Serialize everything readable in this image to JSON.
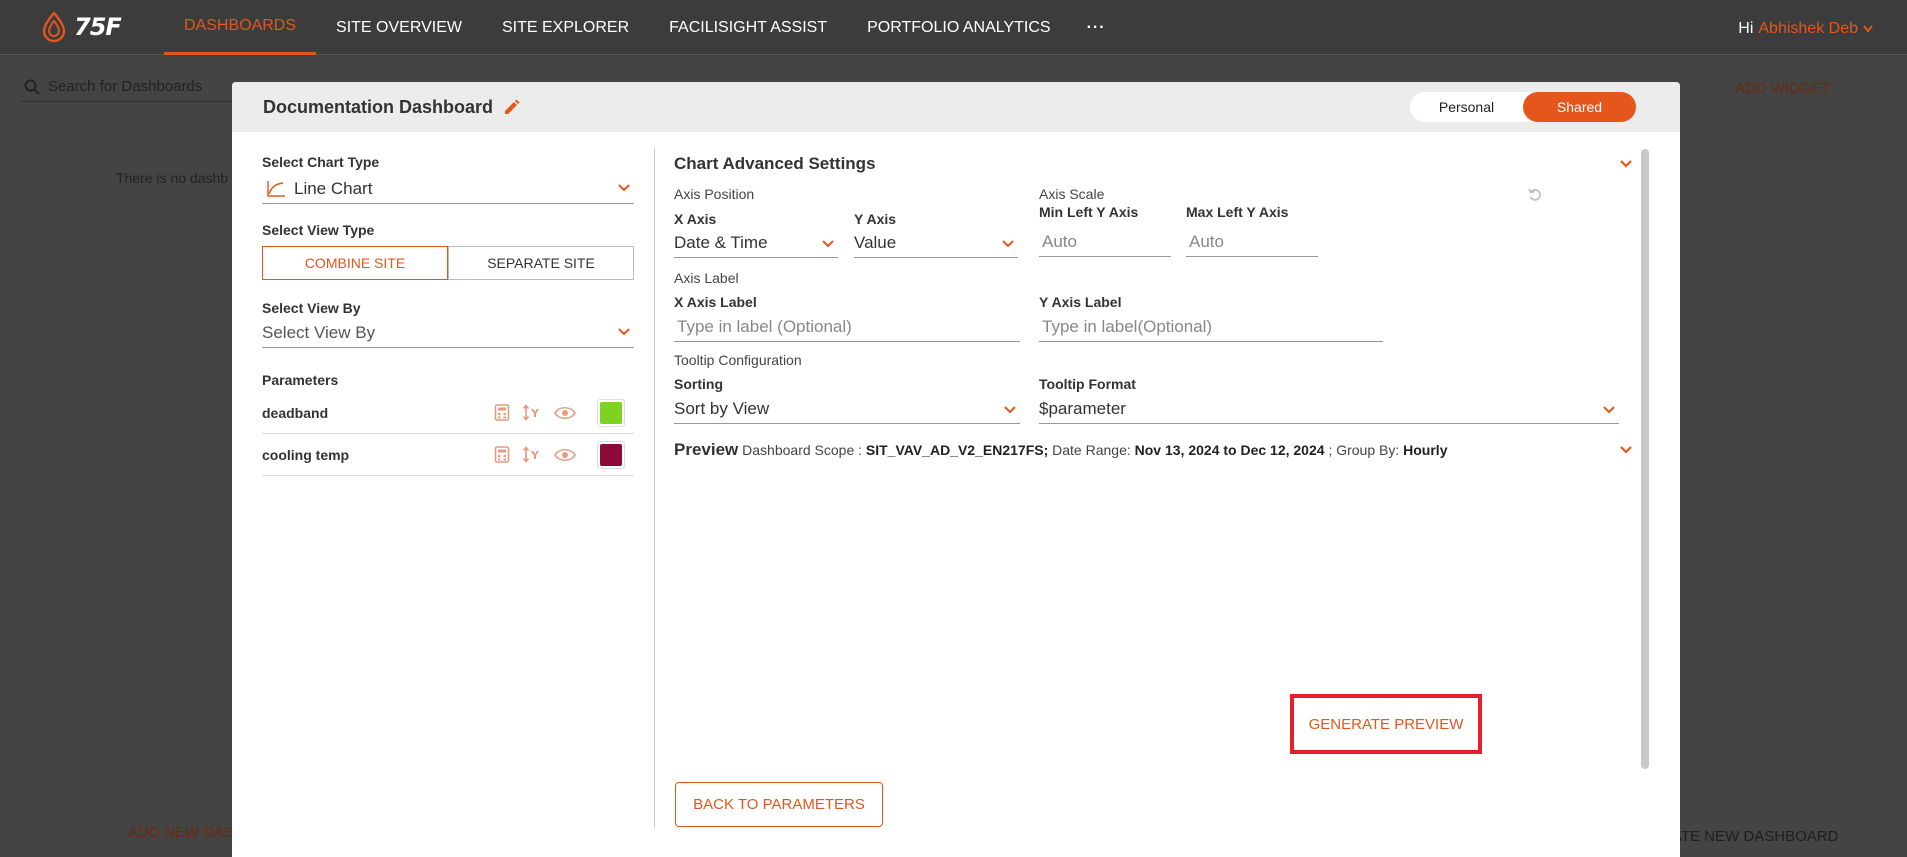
{
  "nav": {
    "logo_text": "75F",
    "items": [
      {
        "label": "DASHBOARDS",
        "active": true
      },
      {
        "label": "SITE OVERVIEW",
        "active": false
      },
      {
        "label": "SITE EXPLORER",
        "active": false
      },
      {
        "label": "FACILISIGHT ASSIST",
        "active": false
      },
      {
        "label": "PORTFOLIO ANALYTICS",
        "active": false
      }
    ],
    "more": "···",
    "greeting": "Hi",
    "user_name": "Abhishek Deb"
  },
  "background": {
    "search_placeholder": "Search for Dashboards",
    "add_widget": "ADD WIDGET",
    "empty_text": "There is no dashb",
    "add_new": "ADD NEW DAS",
    "create_new": "ATE NEW DASHBOARD"
  },
  "modal": {
    "title": "Documentation Dashboard",
    "toggle": {
      "personal": "Personal",
      "shared": "Shared",
      "selected": "Shared"
    },
    "left": {
      "chart_type_label": "Select Chart Type",
      "chart_type_value": "Line Chart",
      "view_type_label": "Select View Type",
      "view_type_options": [
        "COMBINE SITE",
        "SEPARATE SITE"
      ],
      "view_type_selected": "COMBINE SITE",
      "view_by_label": "Select View By",
      "view_by_placeholder": "Select View By",
      "parameters_label": "Parameters",
      "parameters": [
        {
          "name": "deadband",
          "color": "#7ed321"
        },
        {
          "name": "cooling temp",
          "color": "#8b0a3a"
        }
      ]
    },
    "right": {
      "title": "Chart Advanced Settings",
      "axis_position_label": "Axis Position",
      "x_axis_label": "X Axis",
      "x_axis_value": "Date & Time",
      "y_axis_label": "Y Axis",
      "y_axis_value": "Value",
      "axis_scale_label": "Axis Scale",
      "min_left_y_label": "Min Left Y Axis",
      "min_left_y_placeholder": "Auto",
      "max_left_y_label": "Max Left Y Axis",
      "max_left_y_placeholder": "Auto",
      "axis_label_section": "Axis Label",
      "x_axis_label_label": "X Axis Label",
      "x_axis_label_placeholder": "Type in label (Optional)",
      "y_axis_label_label": "Y Axis Label",
      "y_axis_label_placeholder": "Type in label(Optional)",
      "tooltip_section": "Tooltip Configuration",
      "sorting_label": "Sorting",
      "sorting_value": "Sort by View",
      "tooltip_format_label": "Tooltip Format",
      "tooltip_format_value": "$parameter",
      "preview_title": "Preview",
      "preview_scope_label": "Dashboard Scope :",
      "preview_scope_value": "SIT_VAV_AD_V2_EN217FS;",
      "preview_range_label": "Date Range:",
      "preview_range_value": "Nov 13, 2024 to Dec 12, 2024",
      "preview_sep": ";",
      "preview_group_label": "Group By:",
      "preview_group_value": "Hourly",
      "generate_preview": "GENERATE PREVIEW",
      "back_to_parameters": "BACK TO PARAMETERS"
    }
  },
  "colors": {
    "accent": "#e4561b",
    "highlight_border": "#e5202b",
    "nav_bg": "#3c3c3c"
  }
}
